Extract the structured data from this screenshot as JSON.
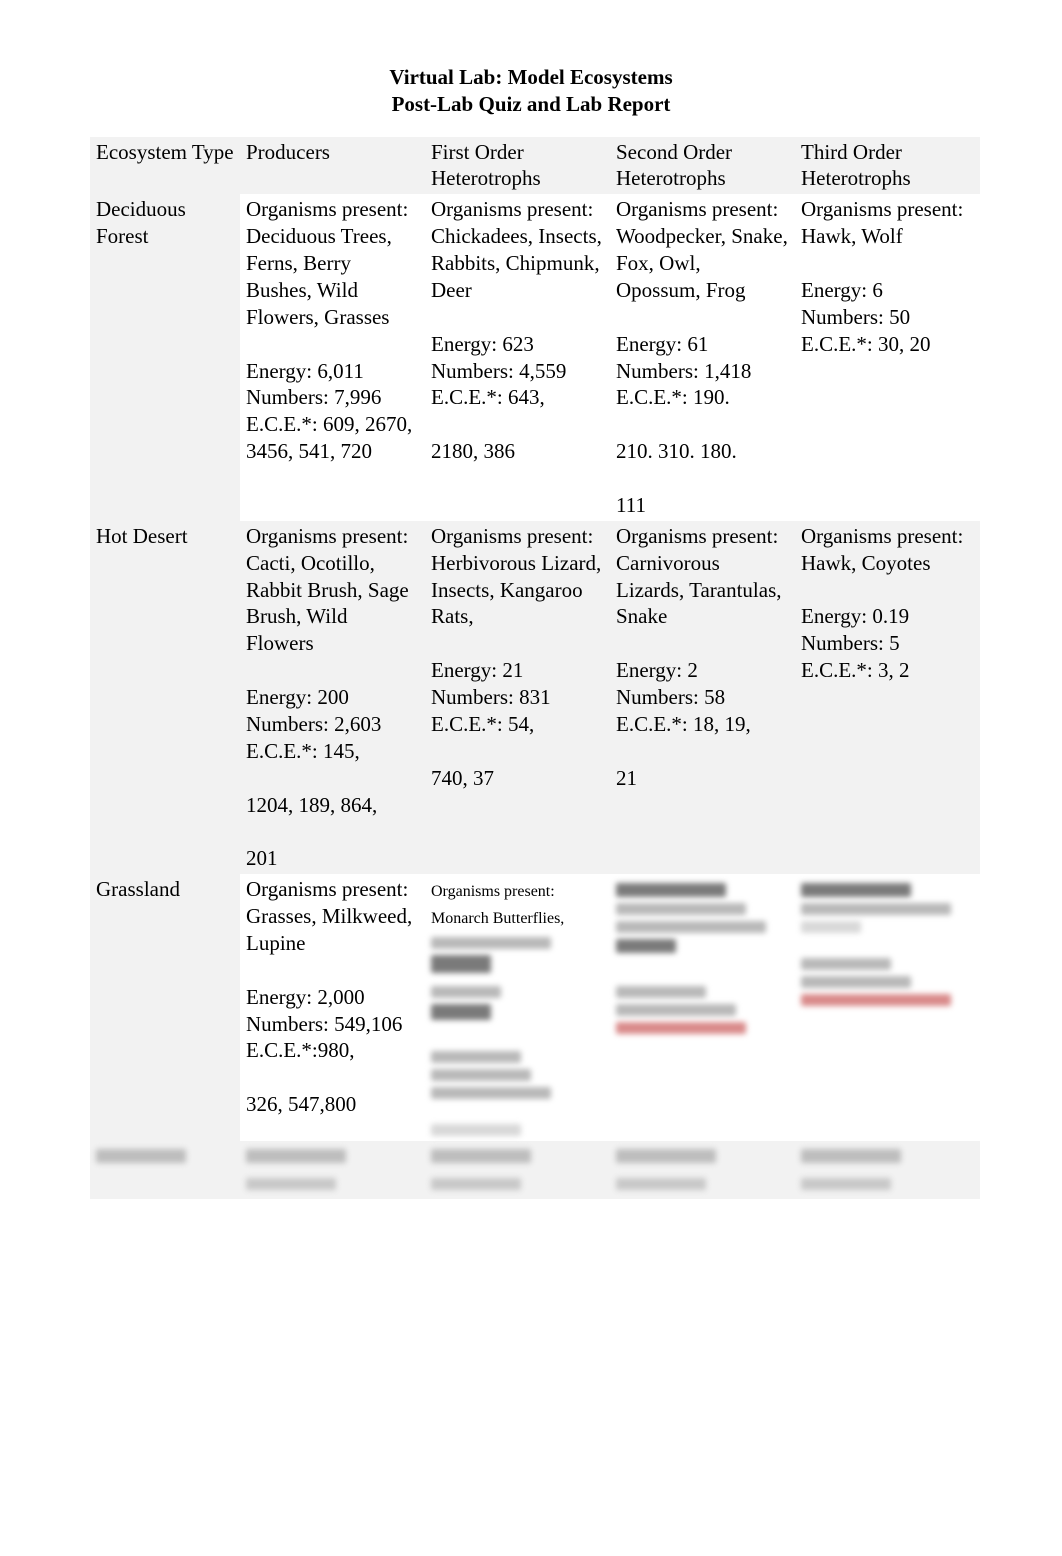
{
  "title_line1": "Virtual Lab:  Model Ecosystems",
  "title_line2": "Post-Lab Quiz and Lab Report",
  "headers": {
    "col1": "Ecosystem Type",
    "col2": "Producers",
    "col3": "First Order Heterotrophs",
    "col4": "Second Order Heterotrophs",
    "col5": "Third Order Heterotrophs"
  },
  "rows": {
    "deciduous": {
      "label": "Deciduous Forest",
      "producers": "Organisms present: Deciduous Trees, Ferns, Berry Bushes, Wild Flowers, Grasses\n\nEnergy: 6,011\nNumbers: 7,996\nE.C.E.*: 609, 2670, 3456, 541, 720",
      "first": "Organisms present: Chickadees, Insects, Rabbits, Chipmunk, Deer\n\nEnergy: 623\nNumbers: 4,559\nE.C.E.*: 643,\n\n2180, 386",
      "second": "Organisms present: Woodpecker, Snake, Fox, Owl, Opossum, Frog\n\nEnergy: 61\nNumbers: 1,418\nE.C.E.*: 190.\n\n210. 310. 180.\n\n111",
      "third": "Organisms present: Hawk, Wolf\n\nEnergy: 6\nNumbers: 50\nE.C.E.*: 30, 20"
    },
    "hotdesert": {
      "label": "Hot Desert",
      "producers": "Organisms present: Cacti, Ocotillo, Rabbit Brush, Sage Brush, Wild Flowers\n\nEnergy: 200\nNumbers: 2,603\nE.C.E.*: 145,\n\n1204, 189, 864,\n\n201",
      "first": "Organisms present: Herbivorous Lizard, Insects, Kangaroo Rats,\n\nEnergy: 21\nNumbers: 831\nE.C.E.*: 54,\n\n740, 37",
      "second": "Organisms present: Carnivorous Lizards, Tarantulas, Snake\n\nEnergy: 2\nNumbers: 58\nE.C.E.*: 18, 19,\n\n21",
      "third": "Organisms present: Hawk, Coyotes\n\nEnergy: 0.19\nNumbers: 5\nE.C.E.*: 3, 2"
    },
    "grassland": {
      "label": "Grassland",
      "producers": "Organisms present: Grasses, Milkweed, Lupine\n\nEnergy: 2,000\nNumbers: 549,106\nE.C.E.*:980,\n\n326, 547,800",
      "first": "Organisms present: Monarch Butterflies,"
    }
  }
}
